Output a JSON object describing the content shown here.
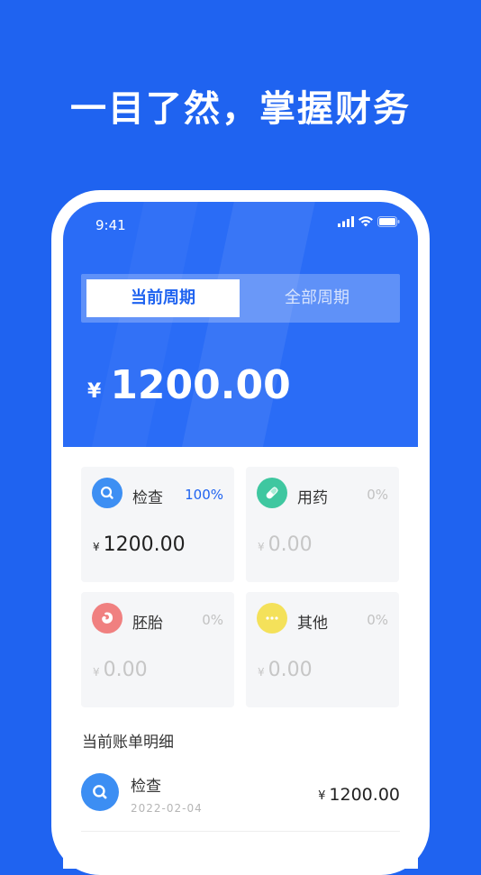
{
  "headline": "一目了然，掌握财务",
  "status": {
    "time": "9:41"
  },
  "tabs": [
    {
      "label": "当前周期",
      "active": true
    },
    {
      "label": "全部周期",
      "active": false
    }
  ],
  "total": {
    "currency": "¥",
    "amount": "1200.00"
  },
  "categories": [
    {
      "name": "检查",
      "percent": "100%",
      "currency": "¥",
      "amount": "1200.00",
      "icon": "search-icon",
      "color": "#3d8ff3"
    },
    {
      "name": "用药",
      "percent": "0%",
      "currency": "¥",
      "amount": "0.00",
      "icon": "pill-icon",
      "color": "#3fc7a0"
    },
    {
      "name": "胚胎",
      "percent": "0%",
      "currency": "¥",
      "amount": "0.00",
      "icon": "embryo-icon",
      "color": "#f08080"
    },
    {
      "name": "其他",
      "percent": "0%",
      "currency": "¥",
      "amount": "0.00",
      "icon": "more-icon",
      "color": "#f4e15a"
    }
  ],
  "details": {
    "title": "当前账单明细",
    "items": [
      {
        "name": "检查",
        "date": "2022-02-04",
        "currency": "¥",
        "amount": "1200.00",
        "icon": "search-icon"
      }
    ]
  },
  "colors": {
    "brand": "#1f63f0",
    "hero": "#2a6cf6"
  }
}
